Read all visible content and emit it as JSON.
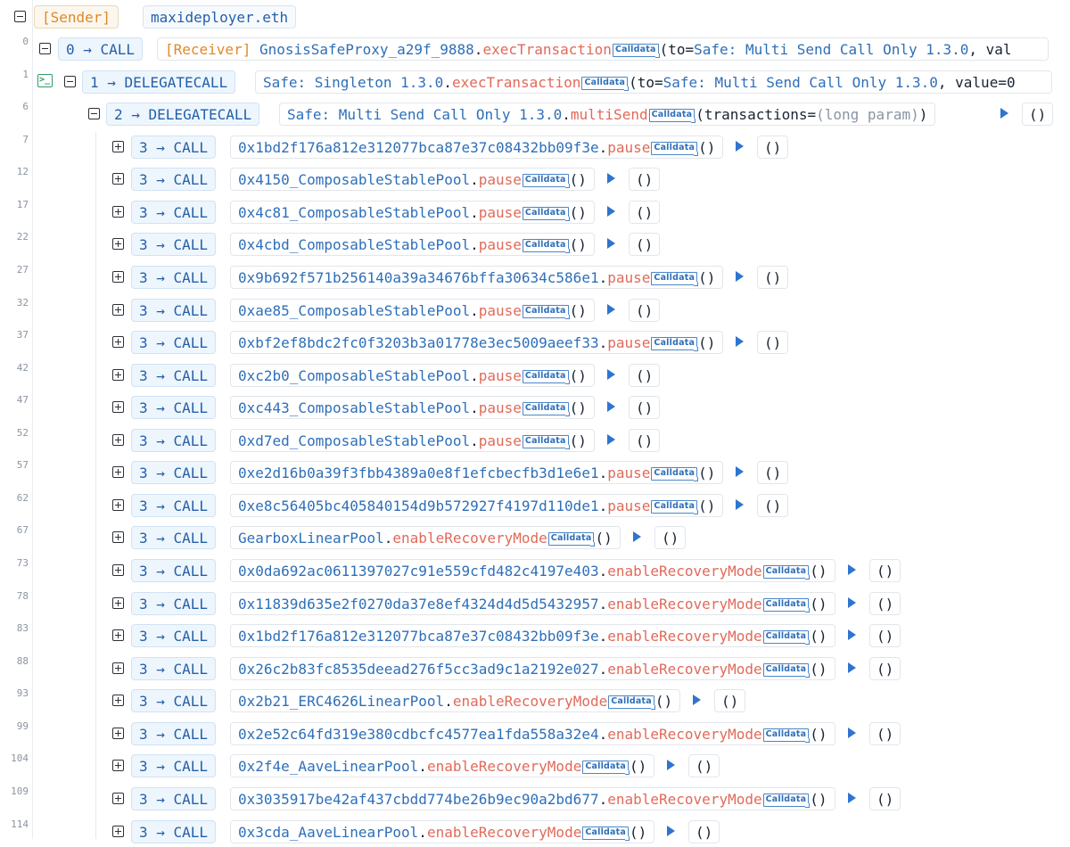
{
  "header": {
    "sender_label": "[Sender]",
    "sender_address": "maxideployer.eth"
  },
  "calldata_label": "Calldata",
  "root_call": {
    "line": "0",
    "call_label": "0 → CALL",
    "receiver_label": "[Receiver]",
    "contract": "GnosisSafeProxy_a29f_9888",
    "method": "execTransaction",
    "args_prefix": "(to=",
    "args_value": "Safe: Multi Send Call Only 1.3.0",
    "args_suffix": ", val"
  },
  "delegate_call_1": {
    "line": "1",
    "call_label": "1 → DELEGATECALL",
    "contract": "Safe: Singleton 1.3.0",
    "method": "execTransaction",
    "args_prefix": "(to=",
    "args_value": "Safe: Multi Send Call Only 1.3.0",
    "args_suffix": ", value=0"
  },
  "delegate_call_2": {
    "line": "6",
    "call_label": "2 → DELEGATECALL",
    "contract": "Safe: Multi Send Call Only 1.3.0",
    "method": "multiSend",
    "args_prefix": "(transactions=",
    "args_value": "(long param)",
    "args_suffix": ")",
    "returns": "()"
  },
  "subcalls": [
    {
      "line": "7",
      "call_label": "3 → CALL",
      "contract": "0x1bd2f176a812e312077bca87e37c08432bb09f3e",
      "method": "pause",
      "args": "()",
      "returns": "()"
    },
    {
      "line": "12",
      "call_label": "3 → CALL",
      "contract": "0x4150_ComposableStablePool",
      "method": "pause",
      "args": "()",
      "returns": "()"
    },
    {
      "line": "17",
      "call_label": "3 → CALL",
      "contract": "0x4c81_ComposableStablePool",
      "method": "pause",
      "args": "()",
      "returns": "()"
    },
    {
      "line": "22",
      "call_label": "3 → CALL",
      "contract": "0x4cbd_ComposableStablePool",
      "method": "pause",
      "args": "()",
      "returns": "()"
    },
    {
      "line": "27",
      "call_label": "3 → CALL",
      "contract": "0x9b692f571b256140a39a34676bffa30634c586e1",
      "method": "pause",
      "args": "()",
      "returns": "()"
    },
    {
      "line": "32",
      "call_label": "3 → CALL",
      "contract": "0xae85_ComposableStablePool",
      "method": "pause",
      "args": "()",
      "returns": "()"
    },
    {
      "line": "37",
      "call_label": "3 → CALL",
      "contract": "0xbf2ef8bdc2fc0f3203b3a01778e3ec5009aeef33",
      "method": "pause",
      "args": "()",
      "returns": "()"
    },
    {
      "line": "42",
      "call_label": "3 → CALL",
      "contract": "0xc2b0_ComposableStablePool",
      "method": "pause",
      "args": "()",
      "returns": "()"
    },
    {
      "line": "47",
      "call_label": "3 → CALL",
      "contract": "0xc443_ComposableStablePool",
      "method": "pause",
      "args": "()",
      "returns": "()"
    },
    {
      "line": "52",
      "call_label": "3 → CALL",
      "contract": "0xd7ed_ComposableStablePool",
      "method": "pause",
      "args": "()",
      "returns": "()"
    },
    {
      "line": "57",
      "call_label": "3 → CALL",
      "contract": "0xe2d16b0a39f3fbb4389a0e8f1efcbecfb3d1e6e1",
      "method": "pause",
      "args": "()",
      "returns": "()"
    },
    {
      "line": "62",
      "call_label": "3 → CALL",
      "contract": "0xe8c56405bc405840154d9b572927f4197d110de1",
      "method": "pause",
      "args": "()",
      "returns": "()"
    },
    {
      "line": "67",
      "call_label": "3 → CALL",
      "contract": "GearboxLinearPool",
      "method": "enableRecoveryMode",
      "args": "()",
      "returns": "()"
    },
    {
      "line": "73",
      "call_label": "3 → CALL",
      "contract": "0x0da692ac0611397027c91e559cfd482c4197e403",
      "method": "enableRecoveryMode",
      "args": "()",
      "returns": "()"
    },
    {
      "line": "78",
      "call_label": "3 → CALL",
      "contract": "0x11839d635e2f0270da37e8ef4324d4d5d5432957",
      "method": "enableRecoveryMode",
      "args": "()",
      "returns": "()"
    },
    {
      "line": "83",
      "call_label": "3 → CALL",
      "contract": "0x1bd2f176a812e312077bca87e37c08432bb09f3e",
      "method": "enableRecoveryMode",
      "args": "()",
      "returns": "()"
    },
    {
      "line": "88",
      "call_label": "3 → CALL",
      "contract": "0x26c2b83fc8535deead276f5cc3ad9c1a2192e027",
      "method": "enableRecoveryMode",
      "args": "()",
      "returns": "()"
    },
    {
      "line": "93",
      "call_label": "3 → CALL",
      "contract": "0x2b21_ERC4626LinearPool",
      "method": "enableRecoveryMode",
      "args": "()",
      "returns": "()"
    },
    {
      "line": "99",
      "call_label": "3 → CALL",
      "contract": "0x2e52c64fd319e380cdbcfc4577ea1fda558a32e4",
      "method": "enableRecoveryMode",
      "args": "()",
      "returns": "()"
    },
    {
      "line": "104",
      "call_label": "3 → CALL",
      "contract": "0x2f4e_AaveLinearPool",
      "method": "enableRecoveryMode",
      "args": "()",
      "returns": "()"
    },
    {
      "line": "109",
      "call_label": "3 → CALL",
      "contract": "0x3035917be42af437cbdd774be26b9ec90a2bd677",
      "method": "enableRecoveryMode",
      "args": "()",
      "returns": "()"
    },
    {
      "line": "114",
      "call_label": "3 → CALL",
      "contract": "0x3cda_AaveLinearPool",
      "method": "enableRecoveryMode",
      "args": "()",
      "returns": "()"
    }
  ]
}
